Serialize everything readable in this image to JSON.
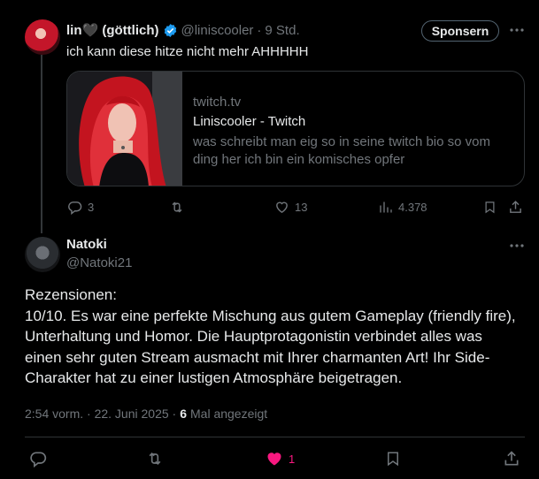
{
  "first_tweet": {
    "display_name": "lin🖤 (göttlich)",
    "handle": "@liniscooler",
    "separator": "·",
    "time": "9 Std.",
    "sponsor_button": "Sponsern",
    "text": "ich kann diese hitze nicht mehr AHHHHH",
    "card": {
      "domain": "twitch.tv",
      "title": "Liniscooler - Twitch",
      "description": "was schreibt man eig so in seine twitch bio so vom ding her ich bin ein komisches opfer"
    },
    "actions": {
      "replies": "3",
      "likes": "13",
      "views": "4.378"
    }
  },
  "main_tweet": {
    "display_name": "Natoki",
    "handle": "@Natoki21",
    "body_lines": [
      "Rezensionen:",
      "10/10. Es war eine perfekte Mischung aus gutem Gameplay (friendly fire),",
      "Unterhaltung und Homor. Die Hauptprotagonistin verbindet alles was",
      "einen sehr guten Stream ausmacht mit Ihrer charmanten Art! Ihr Side-",
      "Charakter hat zu einer lustigen Atmosphäre beigetragen."
    ],
    "timestamp": "2:54 vorm. · 22. Juni 2025 ·",
    "views_count": "6",
    "views_label": "Mal angezeigt",
    "like_count": "1"
  },
  "colors": {
    "background": "#000000",
    "text": "#e7e9ea",
    "muted": "#71767b",
    "verified": "#1d9bf0",
    "like_active": "#f91880",
    "border": "#2f3336"
  }
}
